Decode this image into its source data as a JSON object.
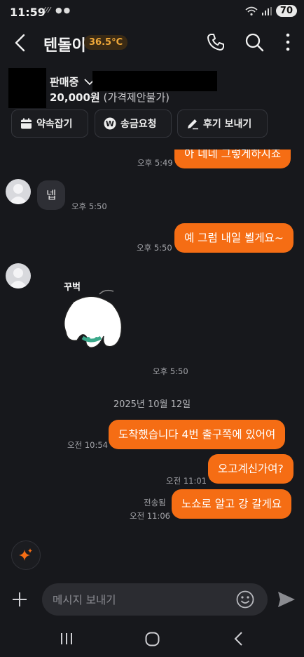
{
  "status_bar": {
    "time": "11:59",
    "left_icons": "⁄⁄⁄ ●●",
    "battery": "70"
  },
  "header": {
    "title": "텐돌이",
    "temperature": "36.5°C",
    "back_icon": "chevron-left-icon",
    "call_icon": "phone-icon",
    "search_icon": "search-icon",
    "more_icon": "more-vertical-icon"
  },
  "product": {
    "status": "판매중",
    "price": "20,000원",
    "price_note": "(가격제안불가)"
  },
  "actions": [
    {
      "label": "약속잡기",
      "icon": "calendar-icon"
    },
    {
      "label": "송금요청",
      "icon": "won-icon"
    },
    {
      "label": "후기 보내기",
      "icon": "pencil-icon"
    }
  ],
  "messages": {
    "m0": {
      "text": "아 네네 그렇게하시죠",
      "time": "오후 5:49"
    },
    "m1": {
      "text": "넵",
      "time": "오후 5:50"
    },
    "m2": {
      "text": "예 그럼 내일 뵐게요~",
      "time": "오후 5:50"
    },
    "m3": {
      "sticker_text": "꾸벅",
      "time": "오후 5:50"
    },
    "date": "2025년 10월 12일",
    "m4": {
      "text": "도착했습니다 4번 출구쪽에 있어여",
      "time": "오전 10:54"
    },
    "m5": {
      "text": "오고계신가여?",
      "time": "오전 11:01"
    },
    "m6": {
      "text": "노쇼로 알고 강 갈게요",
      "status": "전송됨",
      "time": "오전 11:06"
    }
  },
  "composer": {
    "placeholder": "메시지 보내기"
  },
  "colors": {
    "accent": "#f56d14",
    "background": "#17181c",
    "badge_text": "#f0a93a"
  }
}
